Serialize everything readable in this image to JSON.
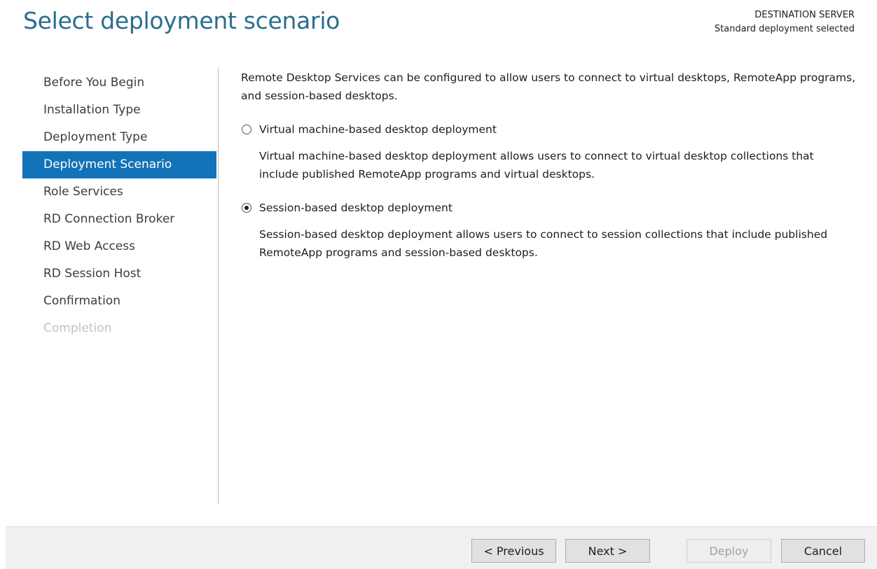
{
  "header": {
    "title": "Select deployment scenario",
    "destination_label": "DESTINATION SERVER",
    "destination_value": "Standard deployment selected"
  },
  "nav": {
    "items": [
      {
        "label": "Before You Begin",
        "state": "normal"
      },
      {
        "label": "Installation Type",
        "state": "normal"
      },
      {
        "label": "Deployment Type",
        "state": "normal"
      },
      {
        "label": "Deployment Scenario",
        "state": "active"
      },
      {
        "label": "Role Services",
        "state": "normal"
      },
      {
        "label": "RD Connection Broker",
        "state": "normal"
      },
      {
        "label": "RD Web Access",
        "state": "normal"
      },
      {
        "label": "RD Session Host",
        "state": "normal"
      },
      {
        "label": "Confirmation",
        "state": "normal"
      },
      {
        "label": "Completion",
        "state": "disabled"
      }
    ]
  },
  "content": {
    "intro": "Remote Desktop Services can be configured to allow users to connect to virtual desktops, RemoteApp programs, and session-based desktops.",
    "options": [
      {
        "label": "Virtual machine-based desktop deployment",
        "selected": false,
        "description": "Virtual machine-based desktop deployment allows users to connect to virtual desktop collections that include published RemoteApp programs and virtual desktops."
      },
      {
        "label": "Session-based desktop deployment",
        "selected": true,
        "description": "Session-based desktop deployment allows users to connect to session collections that include published RemoteApp programs and session-based desktops."
      }
    ]
  },
  "footer": {
    "previous_label": "< Previous",
    "next_label": "Next >",
    "deploy_label": "Deploy",
    "cancel_label": "Cancel"
  },
  "colors": {
    "title": "#2a6e8f",
    "active_nav_bg": "#1373b9",
    "disabled_text": "#c2c2c2"
  }
}
